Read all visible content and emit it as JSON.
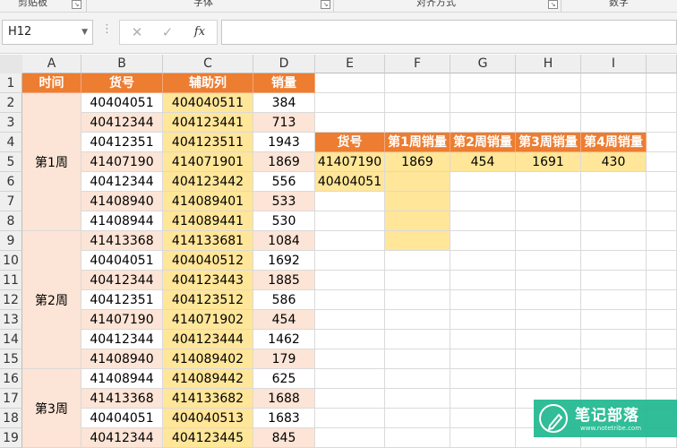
{
  "ribbon": {
    "groups": [
      {
        "label": "剪贴板"
      },
      {
        "label": "字体"
      },
      {
        "label": "对齐方式"
      },
      {
        "label": "数字"
      }
    ]
  },
  "formula_bar": {
    "name_box": "H12",
    "cancel_glyph": "✕",
    "enter_glyph": "✓",
    "fx_glyph": "fx",
    "content": ""
  },
  "columns": [
    "A",
    "B",
    "C",
    "D",
    "E",
    "F",
    "G",
    "H",
    "I"
  ],
  "rows": [
    "1",
    "2",
    "3",
    "4",
    "5",
    "6",
    "7",
    "8",
    "9",
    "10",
    "11",
    "12",
    "13",
    "14",
    "15",
    "16",
    "17",
    "18",
    "19"
  ],
  "header": {
    "a": "时间",
    "b": "货号",
    "c": "辅助列",
    "d": "销量"
  },
  "weeks": [
    {
      "label": "第1周"
    },
    {
      "label": "第2周"
    },
    {
      "label": "第3周"
    }
  ],
  "table_rows": [
    {
      "b": "40404051",
      "c": "404040511",
      "d": "384"
    },
    {
      "b": "40412344",
      "c": "404123441",
      "d": "713"
    },
    {
      "b": "40412351",
      "c": "404123511",
      "d": "1943"
    },
    {
      "b": "41407190",
      "c": "414071901",
      "d": "1869"
    },
    {
      "b": "40412344",
      "c": "404123442",
      "d": "556"
    },
    {
      "b": "41408940",
      "c": "414089401",
      "d": "533"
    },
    {
      "b": "41408944",
      "c": "414089441",
      "d": "530"
    },
    {
      "b": "41413368",
      "c": "414133681",
      "d": "1084"
    },
    {
      "b": "40404051",
      "c": "404040512",
      "d": "1692"
    },
    {
      "b": "40412344",
      "c": "404123443",
      "d": "1885"
    },
    {
      "b": "40412351",
      "c": "404123512",
      "d": "586"
    },
    {
      "b": "41407190",
      "c": "414071902",
      "d": "454"
    },
    {
      "b": "40412344",
      "c": "404123444",
      "d": "1462"
    },
    {
      "b": "41408940",
      "c": "414089402",
      "d": "179"
    },
    {
      "b": "41408944",
      "c": "414089442",
      "d": "625"
    },
    {
      "b": "41413368",
      "c": "414133682",
      "d": "1688"
    },
    {
      "b": "40404051",
      "c": "404040513",
      "d": "1683"
    },
    {
      "b": "40412344",
      "c": "404123445",
      "d": "845"
    }
  ],
  "lookup": {
    "headers": [
      "货号",
      "第1周销量",
      "第2周销量",
      "第3周销量",
      "第4周销量"
    ],
    "row5": [
      "41407190",
      "1869",
      "454",
      "1691",
      "430"
    ],
    "row6": [
      "40404051"
    ]
  },
  "colors": {
    "header_orange": "#ED7D31",
    "peach": "#FCE4D6",
    "yellow": "#FFE699"
  },
  "watermark": {
    "title": "笔记部落",
    "url": "www.notetribe.com"
  }
}
